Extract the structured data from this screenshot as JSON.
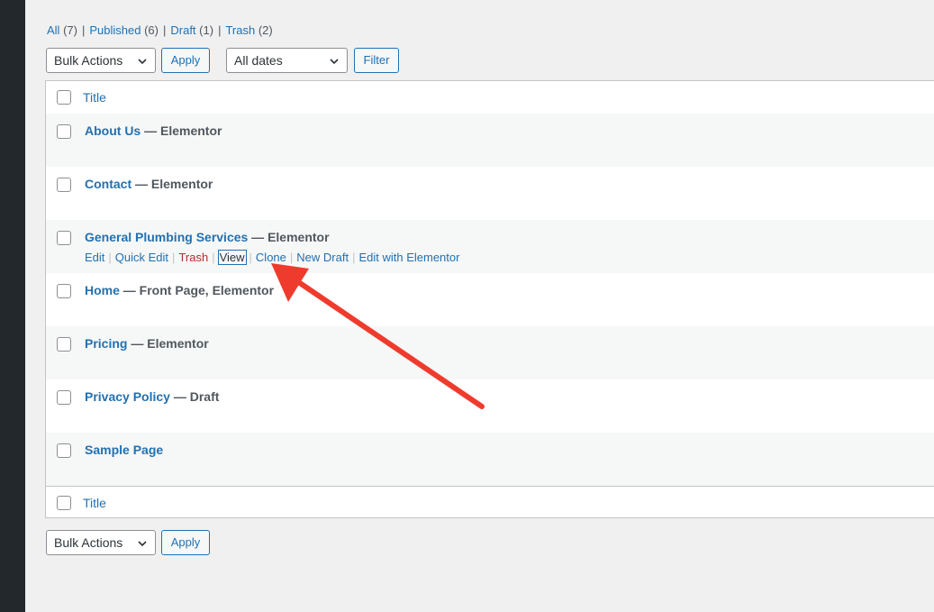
{
  "filters": {
    "all_label": "All",
    "all_count": "(7)",
    "published_label": "Published",
    "published_count": "(6)",
    "draft_label": "Draft",
    "draft_count": "(1)",
    "trash_label": "Trash",
    "trash_count": "(2)",
    "separator": "|"
  },
  "top_nav": {
    "bulk_actions": "Bulk Actions",
    "apply": "Apply",
    "dates": "All dates",
    "filter": "Filter"
  },
  "table": {
    "column_title": "Title",
    "rows": [
      {
        "title": "About Us",
        "state": " — Elementor"
      },
      {
        "title": "Contact",
        "state": " — Elementor"
      },
      {
        "title": "General Plumbing Services",
        "state": " — Elementor",
        "actions": {
          "edit": "Edit",
          "quick_edit": "Quick Edit",
          "trash": "Trash",
          "view": "View",
          "clone": "Clone",
          "new_draft": "New Draft",
          "edit_elementor": "Edit with Elementor"
        }
      },
      {
        "title": "Home",
        "state": " — Front Page, Elementor"
      },
      {
        "title": "Pricing",
        "state": " — Elementor"
      },
      {
        "title": "Privacy Policy",
        "state": " — Draft"
      },
      {
        "title": "Sample Page",
        "state": ""
      }
    ]
  },
  "bottom_nav": {
    "bulk_actions": "Bulk Actions",
    "apply": "Apply"
  },
  "colors": {
    "link": "#2271b1",
    "trash": "#b32d2e",
    "arrow": "#ef3b2d",
    "sidebar": "#23282d"
  }
}
